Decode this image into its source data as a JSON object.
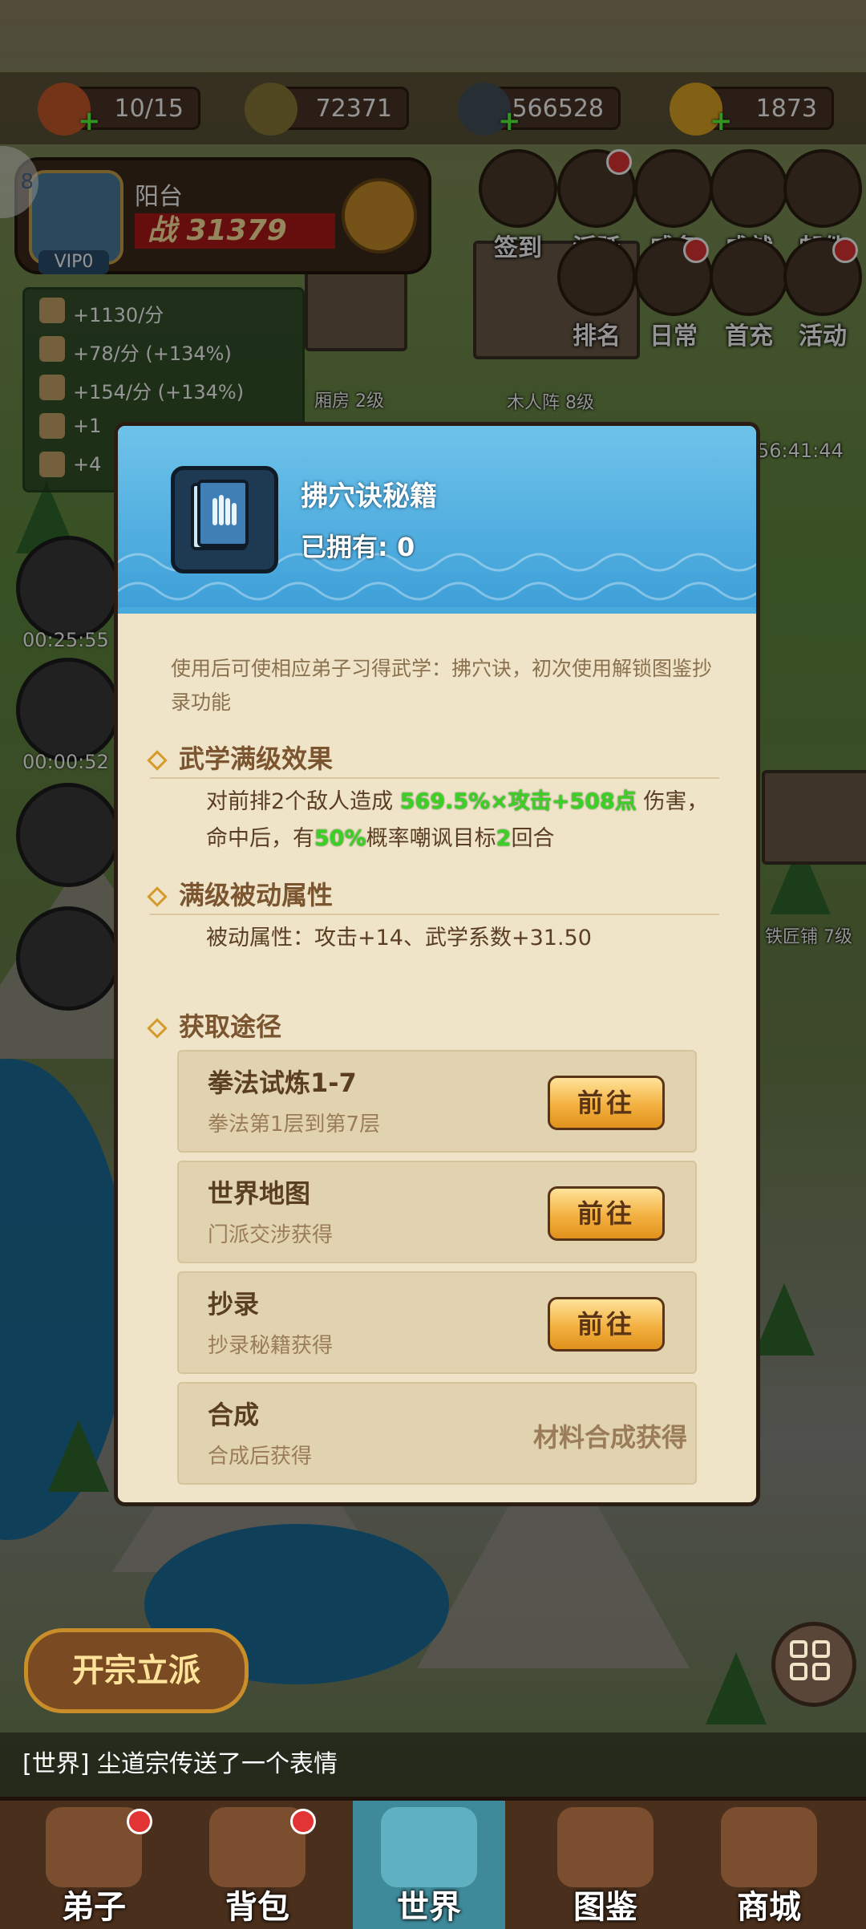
{
  "resources": [
    {
      "name": "stamina",
      "value": "10/15"
    },
    {
      "name": "scroll",
      "value": "72371"
    },
    {
      "name": "coins",
      "value": "566528"
    },
    {
      "name": "ingots",
      "value": "1873"
    }
  ],
  "player": {
    "name": "阳台",
    "vip": "VIP0",
    "power": "31379",
    "power_prefix": "战",
    "level_badge": "8"
  },
  "production": [
    "+1130/分",
    "+78/分 (+134%)",
    "+154/分 (+134%)",
    "+1",
    "+4"
  ],
  "menu": {
    "row1": [
      "签到",
      "活跃",
      "威名",
      "成就",
      "邮件"
    ],
    "row2": [
      "排名",
      "日常",
      "首充",
      "活动"
    ]
  },
  "map_labels": {
    "xiangfang": "厢房 2级",
    "muren": "木人阵 8级",
    "tiejiang": "铁匠铺 7级",
    "countdown": "56:41:44"
  },
  "timers": [
    "00:25:55",
    "00:00:52"
  ],
  "modal": {
    "title": "拂穴诀秘籍",
    "owned": "已拥有: 0",
    "description": "使用后可使相应弟子习得武学：拂穴诀，初次使用解锁图鉴抄录功能",
    "sections": {
      "max_effect": "武学满级效果",
      "passive": "满级被动属性",
      "source": "获取途径"
    },
    "effect": {
      "p1": "对前排2个敌人造成 ",
      "v1": "569.5%×攻击+508点",
      "p2": " 伤害，命中后，有",
      "v2": "50%",
      "p3": "概率嘲讽目标",
      "v3": "2",
      "p4": "回合"
    },
    "passive_text": "被动属性：攻击+14、武学系数+31.50",
    "routes": [
      {
        "name": "拳法试炼1-7",
        "sub": "拳法第1层到第7层",
        "button": "前往"
      },
      {
        "name": "世界地图",
        "sub": "门派交涉获得",
        "button": "前往"
      },
      {
        "name": "抄录",
        "sub": "抄录秘籍获得",
        "button": "前往"
      },
      {
        "name": "合成",
        "sub": "合成后获得",
        "note": "材料合成获得"
      }
    ]
  },
  "sect_button": "开宗立派",
  "chat": "[世界] 尘道宗传送了一个表情",
  "nav": [
    "弟子",
    "背包",
    "世界",
    "图鉴",
    "商城"
  ],
  "colors": {
    "highlight": "#3ad124",
    "modal_header": "#3ea0d8",
    "modal_body": "#f0e4c8",
    "button": "#f3b040"
  }
}
